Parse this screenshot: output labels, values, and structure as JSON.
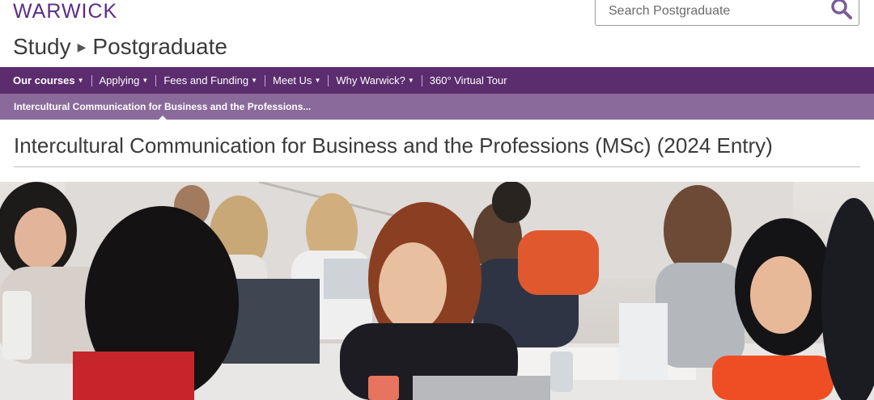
{
  "brand": {
    "logo_text": "WARWICK"
  },
  "search": {
    "placeholder": "Search Postgraduate"
  },
  "breadcrumb": {
    "level1": "Study",
    "level2": "Postgraduate"
  },
  "nav": {
    "items": [
      {
        "label": "Our courses",
        "has_dropdown": true,
        "active": true
      },
      {
        "label": "Applying",
        "has_dropdown": true
      },
      {
        "label": "Fees and Funding",
        "has_dropdown": true
      },
      {
        "label": "Meet Us",
        "has_dropdown": true
      },
      {
        "label": "Why Warwick?",
        "has_dropdown": true
      },
      {
        "label": "360° Virtual Tour",
        "has_dropdown": false
      }
    ]
  },
  "subnav": {
    "current": "Intercultural Communication for Business and the Professions..."
  },
  "page": {
    "title": "Intercultural Communication for Business and the Professions (MSc) (2024 Entry)"
  },
  "colors": {
    "nav_bg": "#5b2d6e",
    "subnav_bg": "#8a6a9a",
    "brand": "#5b2d86"
  },
  "icons": {
    "search": "search-icon",
    "breadcrumb_sep": "caret-right-icon"
  }
}
